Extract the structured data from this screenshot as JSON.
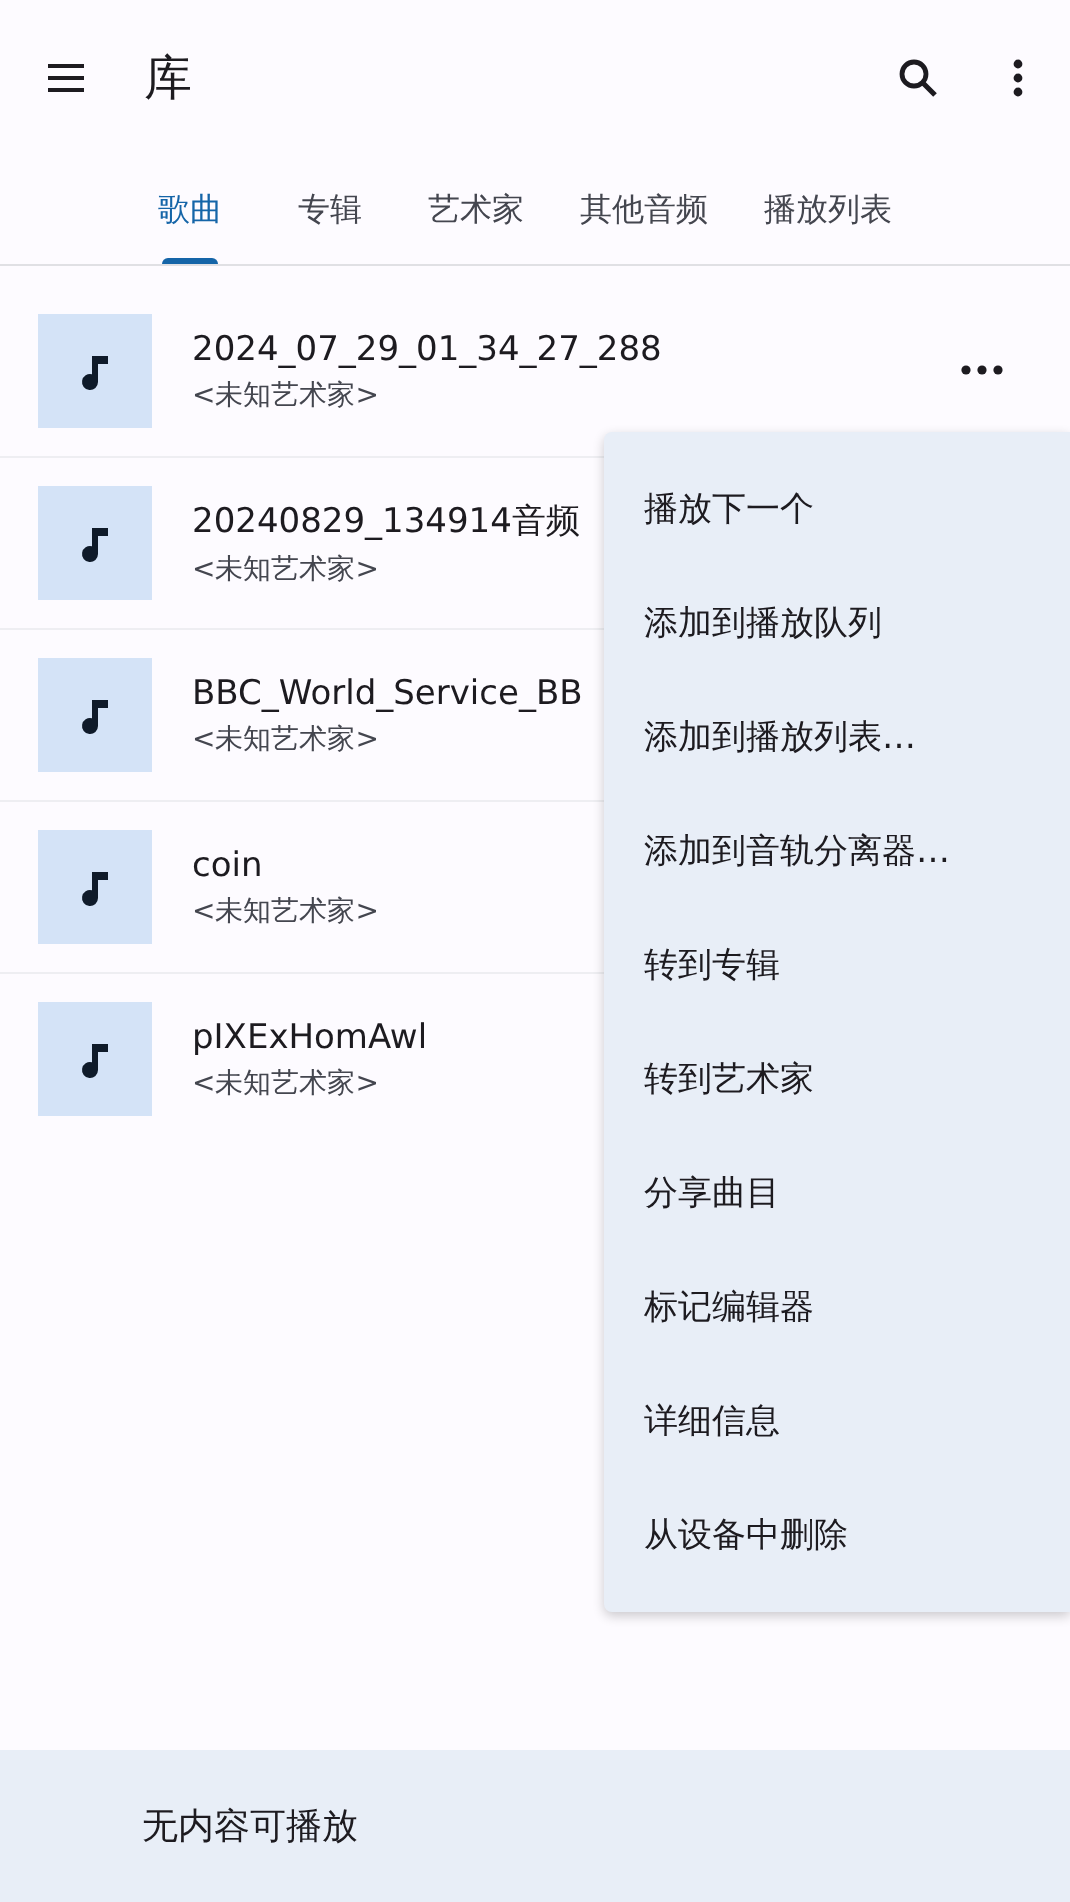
{
  "app_bar": {
    "title": "库"
  },
  "tabs": [
    {
      "label": "歌曲",
      "selected": true
    },
    {
      "label": "专辑",
      "selected": false
    },
    {
      "label": "艺术家",
      "selected": false
    },
    {
      "label": "其他音频",
      "selected": false
    },
    {
      "label": "播放列表",
      "selected": false
    }
  ],
  "songs": [
    {
      "title": "2024_07_29_01_34_27_288",
      "artist": "<未知艺术家>"
    },
    {
      "title": "20240829_134914音频",
      "artist": "<未知艺术家>"
    },
    {
      "title": "BBC_World_Service_BB",
      "artist": "<未知艺术家>"
    },
    {
      "title": "coin",
      "artist": "<未知艺术家>"
    },
    {
      "title": "pIXExHomAwl",
      "artist": "<未知艺术家>"
    }
  ],
  "context_menu": {
    "items": [
      "播放下一个",
      "添加到播放队列",
      "添加到播放列表…",
      "添加到音轨分离器…",
      "转到专辑",
      "转到艺术家",
      "分享曲目",
      "标记编辑器",
      "详细信息",
      "从设备中删除"
    ]
  },
  "mini_player": {
    "text": "无内容可播放"
  }
}
